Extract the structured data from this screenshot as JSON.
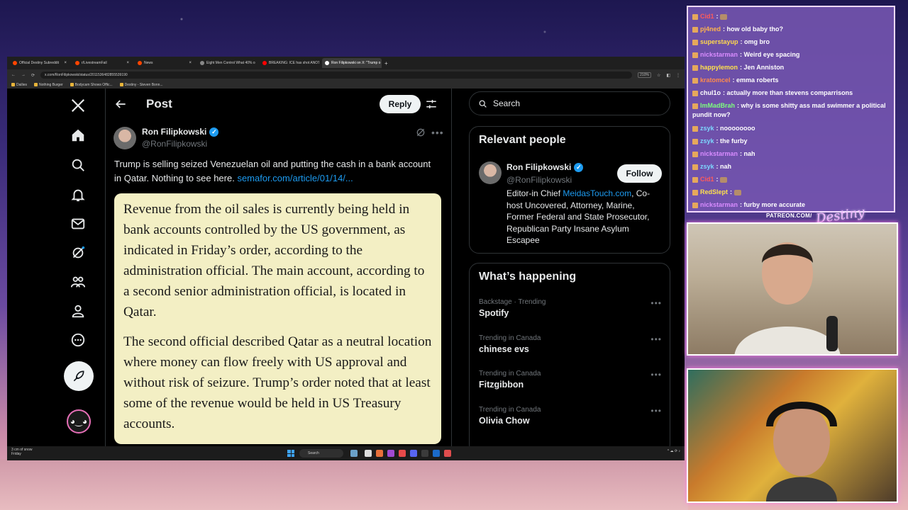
{
  "browser": {
    "tabs": [
      {
        "label": "Official Destiny Subreddit",
        "fav": "#ff4500",
        "active": false
      },
      {
        "label": "r/LivestreamFail",
        "fav": "#ff4500",
        "active": false
      },
      {
        "label": "News",
        "fav": "#ff4500",
        "active": false
      },
      {
        "label": "Eight Men Control What 40% o",
        "fav": "#888888",
        "active": false
      },
      {
        "label": "BREAKING: ICE has shot ANOTH",
        "fav": "#ff0000",
        "active": false
      },
      {
        "label": "Ron Filipkowski on X: \"Trump o",
        "fav": "#ffffff",
        "active": true
      }
    ],
    "url": "x.com/RonFilipkowski/status/2011536482855539190",
    "zoom": "210%",
    "bookmarks": [
      "Dailies",
      "Nothing Burger",
      "Bodycam Shows Offic...",
      "Destiny - Steven Bonn..."
    ]
  },
  "post": {
    "header_title": "Post",
    "reply_label": "Reply",
    "author_name": "Ron Filipkowski",
    "author_handle": "@RonFilipkowski",
    "text": "Trump is selling seized Venezuelan oil and putting the cash in a bank account in Qatar. Nothing to see here.",
    "link": "semafor.com/article/01/14/...",
    "quote_paragraphs": [
      "Revenue from the oil sales is currently being held in bank accounts controlled by the US government, as indicated in Friday’s order, according to the administration official. The main account, according to a second senior administration official, is located in Qatar.",
      "The second official described Qatar as a neutral location where money can flow freely with US approval and without risk of seizure. Trump’s order noted that at least some of the revenue would be held in US Treasury accounts."
    ]
  },
  "sidebar": {
    "search_placeholder": "Search",
    "relevant_title": "Relevant people",
    "person": {
      "name": "Ron Filipkowski",
      "handle": "@RonFilipkowski",
      "follow_label": "Follow",
      "bio_prefix": "Editor-in Chief ",
      "bio_link": "MeidasTouch.com",
      "bio_rest": ", Co-host Uncovered, Attorney, Marine, Former Federal and State Prosecutor, Republican Party Insane Asylum Escapee"
    },
    "happening_title": "What’s happening",
    "trends": [
      {
        "meta": "Backstage · Trending",
        "name": "Spotify"
      },
      {
        "meta": "Trending in Canada",
        "name": "chinese evs"
      },
      {
        "meta": "Trending in Canada",
        "name": "Fitzgibbon"
      },
      {
        "meta": "Trending in Canada",
        "name": "Olivia Chow"
      }
    ]
  },
  "taskbar": {
    "weather_line1": "3 cm of snow",
    "weather_line2": "Friday",
    "search_label": "Search"
  },
  "chat": {
    "messages": [
      {
        "user": "Cid1",
        "color": "#ff5b5b",
        "text": ""
      },
      {
        "user": "pj4ned",
        "color": "#ffb34d",
        "text": "how old baby tho?"
      },
      {
        "user": "superstayup",
        "color": "#ffd84d",
        "text": "omg bro"
      },
      {
        "user": "nickstarman",
        "color": "#d98cff",
        "text": "Weird eye spacing"
      },
      {
        "user": "happylemon",
        "color": "#ffe14d",
        "text": "Jen Anniston"
      },
      {
        "user": "kratomcel",
        "color": "#ff8a4d",
        "text": "emma roberts"
      },
      {
        "user": "chul1o",
        "color": "#ffffff",
        "text": "actually more than stevens comparrisons"
      },
      {
        "user": "ImMadBrah",
        "color": "#7dff7d",
        "text": "why is some shitty ass mad swimmer a political pundit now?"
      },
      {
        "user": "zsyk",
        "color": "#7dd8ff",
        "text": "noooooooo"
      },
      {
        "user": "zsyk",
        "color": "#7dd8ff",
        "text": "the furby"
      },
      {
        "user": "nickstarman",
        "color": "#d98cff",
        "text": "nah"
      },
      {
        "user": "zsyk",
        "color": "#7dd8ff",
        "text": "nah"
      },
      {
        "user": "Cid1",
        "color": "#ff5b5b",
        "text": ""
      },
      {
        "user": "RedSlept",
        "color": "#ffe14d",
        "text": ""
      },
      {
        "user": "nickstarman",
        "color": "#d98cff",
        "text": "furby more accurate"
      }
    ],
    "patreon": "PATREON.COM/"
  },
  "colors": {
    "x_blue": "#1d9bf0",
    "x_text": "#e7e9ea",
    "x_muted": "#71767b",
    "quote_bg": "#f3efc4",
    "chat_bg": "#7656b2"
  }
}
